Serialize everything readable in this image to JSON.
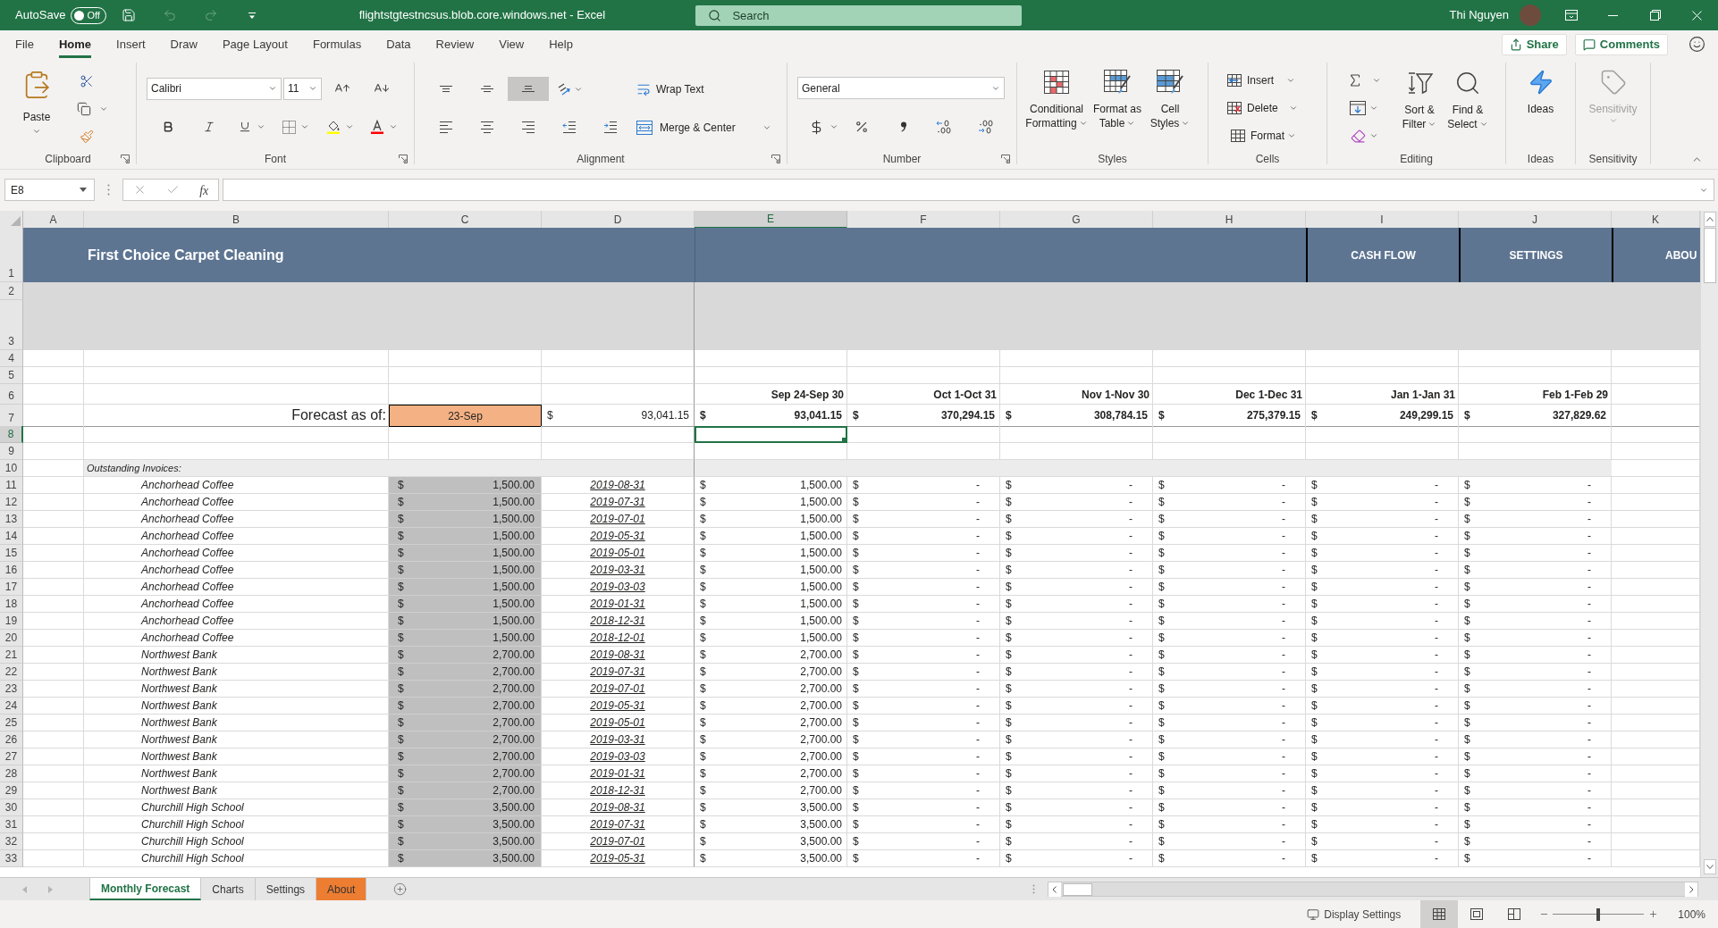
{
  "title_bar": {
    "autosave": {
      "label": "AutoSave",
      "on": false,
      "state_label": "Off"
    },
    "quick_access": [
      {
        "kind": "save",
        "disabled": false
      },
      {
        "kind": "undo",
        "disabled": true
      },
      {
        "kind": "redo",
        "disabled": true
      },
      {
        "kind": "customize",
        "disabled": false
      }
    ],
    "document_title": "flightstgtestncsus.blob.core.windows.net - Excel",
    "search": {
      "placeholder": "Search"
    },
    "user_name": "Thi Nguyen"
  },
  "ribbon_tabs": [
    {
      "label": "File",
      "selected": false
    },
    {
      "label": "Home",
      "selected": true
    },
    {
      "label": "Insert",
      "selected": false
    },
    {
      "label": "Draw",
      "selected": false
    },
    {
      "label": "Page Layout",
      "selected": false
    },
    {
      "label": "Formulas",
      "selected": false
    },
    {
      "label": "Data",
      "selected": false
    },
    {
      "label": "Review",
      "selected": false
    },
    {
      "label": "View",
      "selected": false
    },
    {
      "label": "Help",
      "selected": false
    }
  ],
  "ribbon_actions": [
    {
      "kind": "share",
      "label": "Share"
    },
    {
      "kind": "comments",
      "label": "Comments"
    }
  ],
  "ribbon": {
    "clipboard": {
      "label": "Clipboard",
      "paste": "Paste"
    },
    "font": {
      "label": "Font",
      "font_name": "Calibri",
      "font_size": "11"
    },
    "alignment": {
      "label": "Alignment",
      "vertical": [
        {
          "kind": "top",
          "selected": false
        },
        {
          "kind": "middle",
          "selected": false
        },
        {
          "kind": "bottom",
          "selected": true
        }
      ],
      "wrap_text": "Wrap Text",
      "merge": "Merge & Center"
    },
    "number": {
      "label": "Number",
      "format": "General"
    },
    "styles": {
      "label": "Styles",
      "buttons": [
        {
          "kind": "conditional",
          "lines": [
            "Conditional",
            "Formatting"
          ]
        },
        {
          "kind": "table",
          "lines": [
            "Format as",
            "Table"
          ]
        },
        {
          "kind": "cell",
          "lines": [
            "Cell",
            "Styles"
          ]
        }
      ]
    },
    "cells": {
      "label": "Cells",
      "buttons": [
        {
          "kind": "insert",
          "label": "Insert"
        },
        {
          "kind": "delete",
          "label": "Delete"
        },
        {
          "kind": "format",
          "label": "Format"
        }
      ]
    },
    "editing": {
      "label": "Editing",
      "buttons": [
        {
          "kind": "sort",
          "lines": [
            "Sort &",
            "Filter"
          ]
        },
        {
          "kind": "find",
          "lines": [
            "Find &",
            "Select"
          ]
        }
      ]
    },
    "ideas": {
      "label": "Ideas",
      "button": "Ideas"
    },
    "sensitivity": {
      "label": "Sensitivity",
      "button": "Sensitivity",
      "disabled": true
    }
  },
  "formula_bar": {
    "name_box": "E8",
    "function_label": "fx"
  },
  "sheet": {
    "columns": [
      {
        "label": "A",
        "selected": false
      },
      {
        "label": "B",
        "selected": false
      },
      {
        "label": "C",
        "selected": false
      },
      {
        "label": "D",
        "selected": false
      },
      {
        "label": "E",
        "selected": true
      },
      {
        "label": "F",
        "selected": false
      },
      {
        "label": "G",
        "selected": false
      },
      {
        "label": "H",
        "selected": false
      },
      {
        "label": "I",
        "selected": false
      },
      {
        "label": "J",
        "selected": false
      },
      {
        "label": "K",
        "selected": false
      }
    ],
    "rows": [
      {
        "number": "1",
        "selected": false,
        "kind": "banner",
        "title": "First Choice Carpet Cleaning",
        "links": [
          "CASH FLOW",
          "SETTINGS",
          "ABOU"
        ]
      },
      {
        "number": "2",
        "selected": false,
        "kind": "band"
      },
      {
        "number": "3",
        "selected": false,
        "kind": "band"
      },
      {
        "number": "4",
        "selected": false,
        "kind": "blank"
      },
      {
        "number": "5",
        "selected": false,
        "kind": "blank"
      },
      {
        "number": "6",
        "selected": false,
        "kind": "period_headers",
        "periods": [
          "Sep 24-Sep 30",
          "Oct 1-Oct 31",
          "Nov 1-Nov 30",
          "Dec 1-Dec 31",
          "Jan 1-Jan 31",
          "Feb 1-Feb 29"
        ]
      },
      {
        "number": "7",
        "selected": false,
        "kind": "forecast",
        "label": "Forecast as of:",
        "date": "23-Sep",
        "balance": {
          "kind": "amount",
          "currency": "$",
          "value": "93,041.15"
        },
        "totals": [
          {
            "kind": "amount",
            "currency": "$",
            "value": "93,041.15"
          },
          {
            "kind": "amount",
            "currency": "$",
            "value": "370,294.15"
          },
          {
            "kind": "amount",
            "currency": "$",
            "value": "308,784.15"
          },
          {
            "kind": "amount",
            "currency": "$",
            "value": "275,379.15"
          },
          {
            "kind": "amount",
            "currency": "$",
            "value": "249,299.15"
          },
          {
            "kind": "amount",
            "currency": "$",
            "value": "327,829.62"
          }
        ]
      },
      {
        "number": "8",
        "selected": true,
        "kind": "blank"
      },
      {
        "number": "9",
        "selected": false,
        "kind": "blank"
      },
      {
        "number": "10",
        "selected": false,
        "kind": "section",
        "label": "Outstanding Invoices:"
      },
      {
        "number": "11",
        "selected": false,
        "kind": "invoice",
        "customer": "Anchorhead Coffee",
        "amount": {
          "currency": "$",
          "value": "1,500.00"
        },
        "due_date": "2019-08-31",
        "forecast": [
          {
            "kind": "amount",
            "currency": "$",
            "value": "1,500.00"
          },
          {
            "kind": "zero",
            "currency": "$",
            "value": "-"
          },
          {
            "kind": "zero",
            "currency": "$",
            "value": "-"
          },
          {
            "kind": "zero",
            "currency": "$",
            "value": "-"
          },
          {
            "kind": "zero",
            "currency": "$",
            "value": "-"
          },
          {
            "kind": "zero",
            "currency": "$",
            "value": "-"
          }
        ]
      },
      {
        "number": "12",
        "selected": false,
        "kind": "invoice",
        "customer": "Anchorhead Coffee",
        "amount": {
          "currency": "$",
          "value": "1,500.00"
        },
        "due_date": "2019-07-31",
        "forecast": [
          {
            "kind": "amount",
            "currency": "$",
            "value": "1,500.00"
          },
          {
            "kind": "zero",
            "currency": "$",
            "value": "-"
          },
          {
            "kind": "zero",
            "currency": "$",
            "value": "-"
          },
          {
            "kind": "zero",
            "currency": "$",
            "value": "-"
          },
          {
            "kind": "zero",
            "currency": "$",
            "value": "-"
          },
          {
            "kind": "zero",
            "currency": "$",
            "value": "-"
          }
        ]
      },
      {
        "number": "13",
        "selected": false,
        "kind": "invoice",
        "customer": "Anchorhead Coffee",
        "amount": {
          "currency": "$",
          "value": "1,500.00"
        },
        "due_date": "2019-07-01",
        "forecast": [
          {
            "kind": "amount",
            "currency": "$",
            "value": "1,500.00"
          },
          {
            "kind": "zero",
            "currency": "$",
            "value": "-"
          },
          {
            "kind": "zero",
            "currency": "$",
            "value": "-"
          },
          {
            "kind": "zero",
            "currency": "$",
            "value": "-"
          },
          {
            "kind": "zero",
            "currency": "$",
            "value": "-"
          },
          {
            "kind": "zero",
            "currency": "$",
            "value": "-"
          }
        ]
      },
      {
        "number": "14",
        "selected": false,
        "kind": "invoice",
        "customer": "Anchorhead Coffee",
        "amount": {
          "currency": "$",
          "value": "1,500.00"
        },
        "due_date": "2019-05-31",
        "forecast": [
          {
            "kind": "amount",
            "currency": "$",
            "value": "1,500.00"
          },
          {
            "kind": "zero",
            "currency": "$",
            "value": "-"
          },
          {
            "kind": "zero",
            "currency": "$",
            "value": "-"
          },
          {
            "kind": "zero",
            "currency": "$",
            "value": "-"
          },
          {
            "kind": "zero",
            "currency": "$",
            "value": "-"
          },
          {
            "kind": "zero",
            "currency": "$",
            "value": "-"
          }
        ]
      },
      {
        "number": "15",
        "selected": false,
        "kind": "invoice",
        "customer": "Anchorhead Coffee",
        "amount": {
          "currency": "$",
          "value": "1,500.00"
        },
        "due_date": "2019-05-01",
        "forecast": [
          {
            "kind": "amount",
            "currency": "$",
            "value": "1,500.00"
          },
          {
            "kind": "zero",
            "currency": "$",
            "value": "-"
          },
          {
            "kind": "zero",
            "currency": "$",
            "value": "-"
          },
          {
            "kind": "zero",
            "currency": "$",
            "value": "-"
          },
          {
            "kind": "zero",
            "currency": "$",
            "value": "-"
          },
          {
            "kind": "zero",
            "currency": "$",
            "value": "-"
          }
        ]
      },
      {
        "number": "16",
        "selected": false,
        "kind": "invoice",
        "customer": "Anchorhead Coffee",
        "amount": {
          "currency": "$",
          "value": "1,500.00"
        },
        "due_date": "2019-03-31",
        "forecast": [
          {
            "kind": "amount",
            "currency": "$",
            "value": "1,500.00"
          },
          {
            "kind": "zero",
            "currency": "$",
            "value": "-"
          },
          {
            "kind": "zero",
            "currency": "$",
            "value": "-"
          },
          {
            "kind": "zero",
            "currency": "$",
            "value": "-"
          },
          {
            "kind": "zero",
            "currency": "$",
            "value": "-"
          },
          {
            "kind": "zero",
            "currency": "$",
            "value": "-"
          }
        ]
      },
      {
        "number": "17",
        "selected": false,
        "kind": "invoice",
        "customer": "Anchorhead Coffee",
        "amount": {
          "currency": "$",
          "value": "1,500.00"
        },
        "due_date": "2019-03-03",
        "forecast": [
          {
            "kind": "amount",
            "currency": "$",
            "value": "1,500.00"
          },
          {
            "kind": "zero",
            "currency": "$",
            "value": "-"
          },
          {
            "kind": "zero",
            "currency": "$",
            "value": "-"
          },
          {
            "kind": "zero",
            "currency": "$",
            "value": "-"
          },
          {
            "kind": "zero",
            "currency": "$",
            "value": "-"
          },
          {
            "kind": "zero",
            "currency": "$",
            "value": "-"
          }
        ]
      },
      {
        "number": "18",
        "selected": false,
        "kind": "invoice",
        "customer": "Anchorhead Coffee",
        "amount": {
          "currency": "$",
          "value": "1,500.00"
        },
        "due_date": "2019-01-31",
        "forecast": [
          {
            "kind": "amount",
            "currency": "$",
            "value": "1,500.00"
          },
          {
            "kind": "zero",
            "currency": "$",
            "value": "-"
          },
          {
            "kind": "zero",
            "currency": "$",
            "value": "-"
          },
          {
            "kind": "zero",
            "currency": "$",
            "value": "-"
          },
          {
            "kind": "zero",
            "currency": "$",
            "value": "-"
          },
          {
            "kind": "zero",
            "currency": "$",
            "value": "-"
          }
        ]
      },
      {
        "number": "19",
        "selected": false,
        "kind": "invoice",
        "customer": "Anchorhead Coffee",
        "amount": {
          "currency": "$",
          "value": "1,500.00"
        },
        "due_date": "2018-12-31",
        "forecast": [
          {
            "kind": "amount",
            "currency": "$",
            "value": "1,500.00"
          },
          {
            "kind": "zero",
            "currency": "$",
            "value": "-"
          },
          {
            "kind": "zero",
            "currency": "$",
            "value": "-"
          },
          {
            "kind": "zero",
            "currency": "$",
            "value": "-"
          },
          {
            "kind": "zero",
            "currency": "$",
            "value": "-"
          },
          {
            "kind": "zero",
            "currency": "$",
            "value": "-"
          }
        ]
      },
      {
        "number": "20",
        "selected": false,
        "kind": "invoice",
        "customer": "Anchorhead Coffee",
        "amount": {
          "currency": "$",
          "value": "1,500.00"
        },
        "due_date": "2018-12-01",
        "forecast": [
          {
            "kind": "amount",
            "currency": "$",
            "value": "1,500.00"
          },
          {
            "kind": "zero",
            "currency": "$",
            "value": "-"
          },
          {
            "kind": "zero",
            "currency": "$",
            "value": "-"
          },
          {
            "kind": "zero",
            "currency": "$",
            "value": "-"
          },
          {
            "kind": "zero",
            "currency": "$",
            "value": "-"
          },
          {
            "kind": "zero",
            "currency": "$",
            "value": "-"
          }
        ]
      },
      {
        "number": "21",
        "selected": false,
        "kind": "invoice",
        "customer": "Northwest Bank",
        "amount": {
          "currency": "$",
          "value": "2,700.00"
        },
        "due_date": "2019-08-31",
        "forecast": [
          {
            "kind": "amount",
            "currency": "$",
            "value": "2,700.00"
          },
          {
            "kind": "zero",
            "currency": "$",
            "value": "-"
          },
          {
            "kind": "zero",
            "currency": "$",
            "value": "-"
          },
          {
            "kind": "zero",
            "currency": "$",
            "value": "-"
          },
          {
            "kind": "zero",
            "currency": "$",
            "value": "-"
          },
          {
            "kind": "zero",
            "currency": "$",
            "value": "-"
          }
        ]
      },
      {
        "number": "22",
        "selected": false,
        "kind": "invoice",
        "customer": "Northwest Bank",
        "amount": {
          "currency": "$",
          "value": "2,700.00"
        },
        "due_date": "2019-07-31",
        "forecast": [
          {
            "kind": "amount",
            "currency": "$",
            "value": "2,700.00"
          },
          {
            "kind": "zero",
            "currency": "$",
            "value": "-"
          },
          {
            "kind": "zero",
            "currency": "$",
            "value": "-"
          },
          {
            "kind": "zero",
            "currency": "$",
            "value": "-"
          },
          {
            "kind": "zero",
            "currency": "$",
            "value": "-"
          },
          {
            "kind": "zero",
            "currency": "$",
            "value": "-"
          }
        ]
      },
      {
        "number": "23",
        "selected": false,
        "kind": "invoice",
        "customer": "Northwest Bank",
        "amount": {
          "currency": "$",
          "value": "2,700.00"
        },
        "due_date": "2019-07-01",
        "forecast": [
          {
            "kind": "amount",
            "currency": "$",
            "value": "2,700.00"
          },
          {
            "kind": "zero",
            "currency": "$",
            "value": "-"
          },
          {
            "kind": "zero",
            "currency": "$",
            "value": "-"
          },
          {
            "kind": "zero",
            "currency": "$",
            "value": "-"
          },
          {
            "kind": "zero",
            "currency": "$",
            "value": "-"
          },
          {
            "kind": "zero",
            "currency": "$",
            "value": "-"
          }
        ]
      },
      {
        "number": "24",
        "selected": false,
        "kind": "invoice",
        "customer": "Northwest Bank",
        "amount": {
          "currency": "$",
          "value": "2,700.00"
        },
        "due_date": "2019-05-31",
        "forecast": [
          {
            "kind": "amount",
            "currency": "$",
            "value": "2,700.00"
          },
          {
            "kind": "zero",
            "currency": "$",
            "value": "-"
          },
          {
            "kind": "zero",
            "currency": "$",
            "value": "-"
          },
          {
            "kind": "zero",
            "currency": "$",
            "value": "-"
          },
          {
            "kind": "zero",
            "currency": "$",
            "value": "-"
          },
          {
            "kind": "zero",
            "currency": "$",
            "value": "-"
          }
        ]
      },
      {
        "number": "25",
        "selected": false,
        "kind": "invoice",
        "customer": "Northwest Bank",
        "amount": {
          "currency": "$",
          "value": "2,700.00"
        },
        "due_date": "2019-05-01",
        "forecast": [
          {
            "kind": "amount",
            "currency": "$",
            "value": "2,700.00"
          },
          {
            "kind": "zero",
            "currency": "$",
            "value": "-"
          },
          {
            "kind": "zero",
            "currency": "$",
            "value": "-"
          },
          {
            "kind": "zero",
            "currency": "$",
            "value": "-"
          },
          {
            "kind": "zero",
            "currency": "$",
            "value": "-"
          },
          {
            "kind": "zero",
            "currency": "$",
            "value": "-"
          }
        ]
      },
      {
        "number": "26",
        "selected": false,
        "kind": "invoice",
        "customer": "Northwest Bank",
        "amount": {
          "currency": "$",
          "value": "2,700.00"
        },
        "due_date": "2019-03-31",
        "forecast": [
          {
            "kind": "amount",
            "currency": "$",
            "value": "2,700.00"
          },
          {
            "kind": "zero",
            "currency": "$",
            "value": "-"
          },
          {
            "kind": "zero",
            "currency": "$",
            "value": "-"
          },
          {
            "kind": "zero",
            "currency": "$",
            "value": "-"
          },
          {
            "kind": "zero",
            "currency": "$",
            "value": "-"
          },
          {
            "kind": "zero",
            "currency": "$",
            "value": "-"
          }
        ]
      },
      {
        "number": "27",
        "selected": false,
        "kind": "invoice",
        "customer": "Northwest Bank",
        "amount": {
          "currency": "$",
          "value": "2,700.00"
        },
        "due_date": "2019-03-03",
        "forecast": [
          {
            "kind": "amount",
            "currency": "$",
            "value": "2,700.00"
          },
          {
            "kind": "zero",
            "currency": "$",
            "value": "-"
          },
          {
            "kind": "zero",
            "currency": "$",
            "value": "-"
          },
          {
            "kind": "zero",
            "currency": "$",
            "value": "-"
          },
          {
            "kind": "zero",
            "currency": "$",
            "value": "-"
          },
          {
            "kind": "zero",
            "currency": "$",
            "value": "-"
          }
        ]
      },
      {
        "number": "28",
        "selected": false,
        "kind": "invoice",
        "customer": "Northwest Bank",
        "amount": {
          "currency": "$",
          "value": "2,700.00"
        },
        "due_date": "2019-01-31",
        "forecast": [
          {
            "kind": "amount",
            "currency": "$",
            "value": "2,700.00"
          },
          {
            "kind": "zero",
            "currency": "$",
            "value": "-"
          },
          {
            "kind": "zero",
            "currency": "$",
            "value": "-"
          },
          {
            "kind": "zero",
            "currency": "$",
            "value": "-"
          },
          {
            "kind": "zero",
            "currency": "$",
            "value": "-"
          },
          {
            "kind": "zero",
            "currency": "$",
            "value": "-"
          }
        ]
      },
      {
        "number": "29",
        "selected": false,
        "kind": "invoice",
        "customer": "Northwest Bank",
        "amount": {
          "currency": "$",
          "value": "2,700.00"
        },
        "due_date": "2018-12-31",
        "forecast": [
          {
            "kind": "amount",
            "currency": "$",
            "value": "2,700.00"
          },
          {
            "kind": "zero",
            "currency": "$",
            "value": "-"
          },
          {
            "kind": "zero",
            "currency": "$",
            "value": "-"
          },
          {
            "kind": "zero",
            "currency": "$",
            "value": "-"
          },
          {
            "kind": "zero",
            "currency": "$",
            "value": "-"
          },
          {
            "kind": "zero",
            "currency": "$",
            "value": "-"
          }
        ]
      },
      {
        "number": "30",
        "selected": false,
        "kind": "invoice",
        "customer": "Churchill High School",
        "amount": {
          "currency": "$",
          "value": "3,500.00"
        },
        "due_date": "2019-08-31",
        "forecast": [
          {
            "kind": "amount",
            "currency": "$",
            "value": "3,500.00"
          },
          {
            "kind": "zero",
            "currency": "$",
            "value": "-"
          },
          {
            "kind": "zero",
            "currency": "$",
            "value": "-"
          },
          {
            "kind": "zero",
            "currency": "$",
            "value": "-"
          },
          {
            "kind": "zero",
            "currency": "$",
            "value": "-"
          },
          {
            "kind": "zero",
            "currency": "$",
            "value": "-"
          }
        ]
      },
      {
        "number": "31",
        "selected": false,
        "kind": "invoice",
        "customer": "Churchill High School",
        "amount": {
          "currency": "$",
          "value": "3,500.00"
        },
        "due_date": "2019-07-31",
        "forecast": [
          {
            "kind": "amount",
            "currency": "$",
            "value": "3,500.00"
          },
          {
            "kind": "zero",
            "currency": "$",
            "value": "-"
          },
          {
            "kind": "zero",
            "currency": "$",
            "value": "-"
          },
          {
            "kind": "zero",
            "currency": "$",
            "value": "-"
          },
          {
            "kind": "zero",
            "currency": "$",
            "value": "-"
          },
          {
            "kind": "zero",
            "currency": "$",
            "value": "-"
          }
        ]
      },
      {
        "number": "32",
        "selected": false,
        "kind": "invoice",
        "customer": "Churchill High School",
        "amount": {
          "currency": "$",
          "value": "3,500.00"
        },
        "due_date": "2019-07-01",
        "forecast": [
          {
            "kind": "amount",
            "currency": "$",
            "value": "3,500.00"
          },
          {
            "kind": "zero",
            "currency": "$",
            "value": "-"
          },
          {
            "kind": "zero",
            "currency": "$",
            "value": "-"
          },
          {
            "kind": "zero",
            "currency": "$",
            "value": "-"
          },
          {
            "kind": "zero",
            "currency": "$",
            "value": "-"
          },
          {
            "kind": "zero",
            "currency": "$",
            "value": "-"
          }
        ]
      },
      {
        "number": "33",
        "selected": false,
        "kind": "invoice",
        "customer": "Churchill High School",
        "amount": {
          "currency": "$",
          "value": "3,500.00"
        },
        "due_date": "2019-05-31",
        "forecast": [
          {
            "kind": "amount",
            "currency": "$",
            "value": "3,500.00"
          },
          {
            "kind": "zero",
            "currency": "$",
            "value": "-"
          },
          {
            "kind": "zero",
            "currency": "$",
            "value": "-"
          },
          {
            "kind": "zero",
            "currency": "$",
            "value": "-"
          },
          {
            "kind": "zero",
            "currency": "$",
            "value": "-"
          },
          {
            "kind": "zero",
            "currency": "$",
            "value": "-"
          }
        ]
      }
    ]
  },
  "sheet_tabs": [
    {
      "label": "Monthly Forecast",
      "selected": true
    },
    {
      "label": "Charts",
      "selected": false
    },
    {
      "label": "Settings",
      "selected": false
    },
    {
      "label": "About",
      "selected": false,
      "color": "#ed7d31"
    }
  ],
  "status_bar": {
    "display_settings": "Display Settings",
    "views": [
      {
        "kind": "normal",
        "selected": true
      },
      {
        "kind": "page_layout",
        "selected": false
      },
      {
        "kind": "page_break",
        "selected": false
      }
    ],
    "zoom": {
      "level": 0.5,
      "label": "100%"
    }
  }
}
